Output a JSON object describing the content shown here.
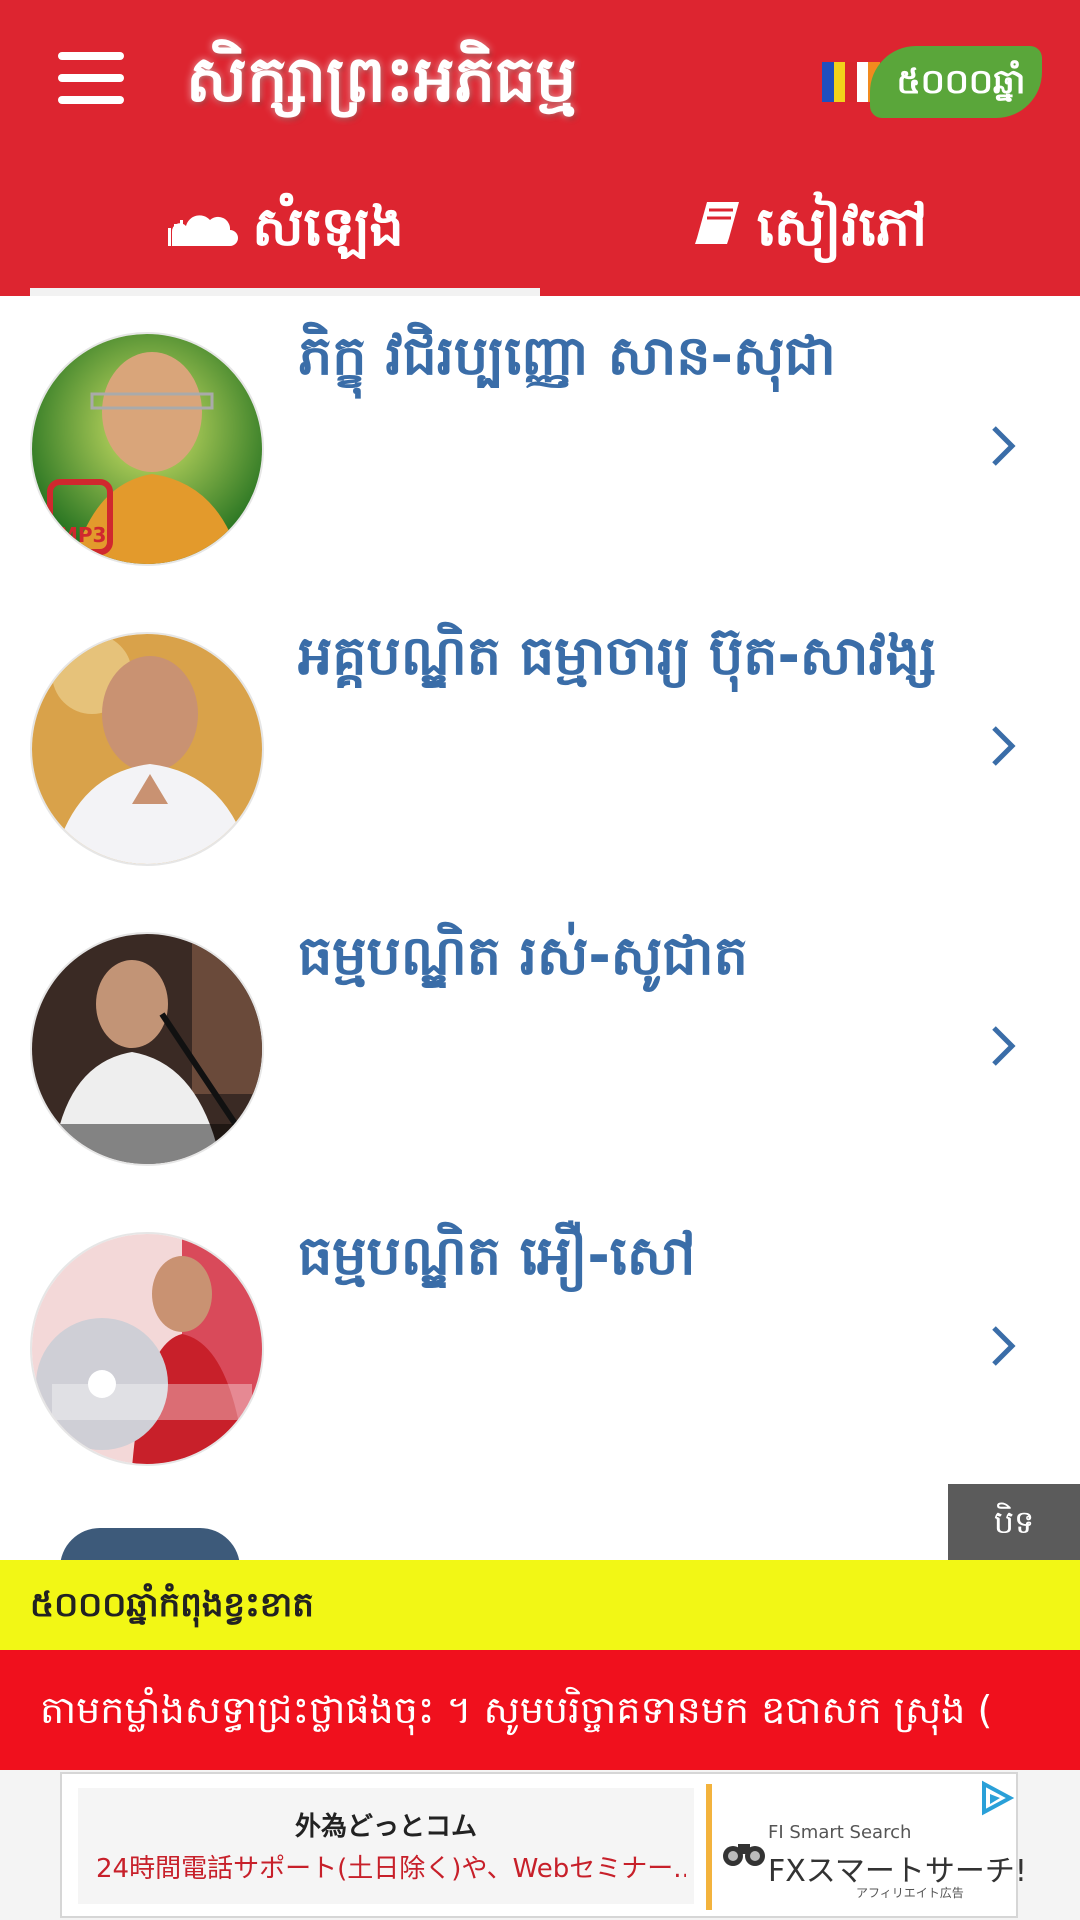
{
  "header": {
    "app_title": "សិក្សាព្រះអភិធម្ម",
    "badge_text": "៥០០០ឆ្នាំ",
    "flag_colors": [
      "#1f4fbf",
      "#f2d21a",
      "#d8262c",
      "#ffffff",
      "#f28a1e"
    ]
  },
  "tabs": [
    {
      "label": "សំឡេង",
      "icon": "cloud-icon",
      "active": true
    },
    {
      "label": "សៀវភៅ",
      "icon": "book-icon",
      "active": false
    }
  ],
  "teachers": [
    {
      "name": "ភិក្ខុ វជិរប្បញ្ញោ សាន-សុជា",
      "avatar": "monk-portrait-mp3"
    },
    {
      "name": "អគ្គបណ្ឌិត ធម្មាចារ្យ ប៊ុត-សាវង្ស",
      "avatar": "teacher-portrait-white-robe"
    },
    {
      "name": "ធម្មបណ្ឌិត រស់-សូជាត",
      "avatar": "teacher-preaching-microphone"
    },
    {
      "name": "ធម្មបណ្ឌិត អឿ-សៅ",
      "avatar": "teacher-cd-cover"
    }
  ],
  "overlay": {
    "close_label": "បិទ",
    "notice": "៥០០០ឆ្នាំកំពុងខ្វះខាត",
    "marquee": "តាមកម្លាំងសទ្ធាជ្រះថ្លាផងចុះ ។ សូមបរិច្ចាគទានមក ឧបាសក ស្រុង ("
  },
  "ad": {
    "title": "外為どっとコム",
    "description": "24時間電話サポート(土日除く)や、Webセミナー...",
    "right_small": "FI Smart Search",
    "right_big": "FXスマートサーチ!",
    "right_sub": "アフィリエイト広告"
  },
  "colors": {
    "header_red": "#dd2530",
    "name_blue": "#3a6da8",
    "notice_yellow": "#f2f715",
    "marquee_red": "#f0101d"
  }
}
